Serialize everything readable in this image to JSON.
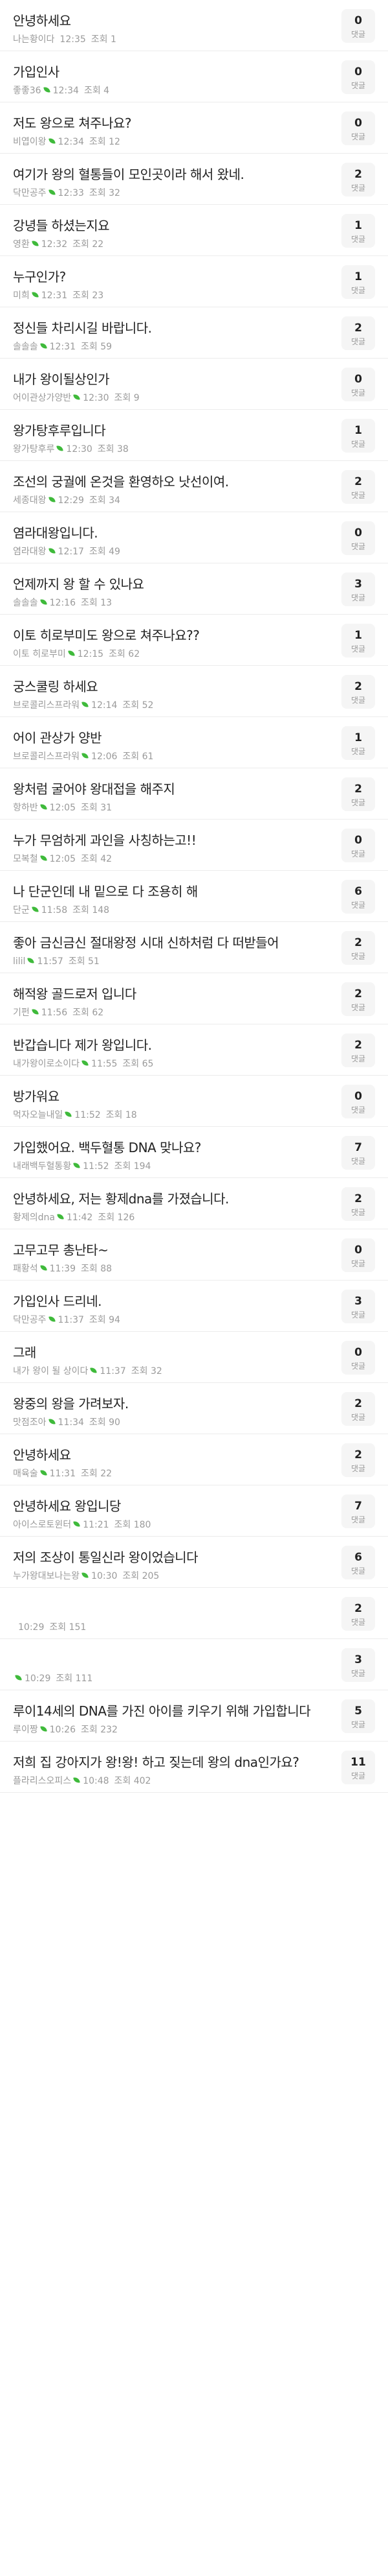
{
  "comment_label": "댓글",
  "colors": {
    "leaf_accent": "#3fba3b",
    "comment_box_bg": "#f5f5f5"
  },
  "posts": [
    {
      "title": "안녕하세요",
      "author": "나는황이다",
      "verified": false,
      "time": "12:35",
      "views": "조회 1",
      "comments": "0"
    },
    {
      "title": "가입인사",
      "author": "좋좋36",
      "verified": true,
      "time": "12:34",
      "views": "조회 4",
      "comments": "0"
    },
    {
      "title": "저도 왕으로 쳐주나요?",
      "author": "비엽이왕",
      "verified": true,
      "time": "12:34",
      "views": "조회 12",
      "comments": "0"
    },
    {
      "title": "여기가 왕의 혈통들이 모인곳이라 해서 왔네.",
      "author": "닥만공주",
      "verified": true,
      "time": "12:33",
      "views": "조회 32",
      "comments": "2"
    },
    {
      "title": "강녕들 하셨는지요",
      "author": "영환",
      "verified": true,
      "time": "12:32",
      "views": "조회 22",
      "comments": "1"
    },
    {
      "title": "누구인가?",
      "author": "미희",
      "verified": true,
      "time": "12:31",
      "views": "조회 23",
      "comments": "1"
    },
    {
      "title": "정신들 차리시길 바랍니다.",
      "author": "솔솔솔",
      "verified": true,
      "time": "12:31",
      "views": "조회 59",
      "comments": "2"
    },
    {
      "title": "내가 왕이될상인가",
      "author": "어이관상가양반",
      "verified": true,
      "time": "12:30",
      "views": "조회 9",
      "comments": "0"
    },
    {
      "title": "왕가탕후루입니다",
      "author": "왕가탕후루",
      "verified": true,
      "time": "12:30",
      "views": "조회 38",
      "comments": "1"
    },
    {
      "title": "조선의 궁궐에 온것을 환영하오 낫선이여.",
      "author": "세종대왕",
      "verified": true,
      "time": "12:29",
      "views": "조회 34",
      "comments": "2"
    },
    {
      "title": "염라대왕입니다.",
      "author": "염라대왕",
      "verified": true,
      "time": "12:17",
      "views": "조회 49",
      "comments": "0"
    },
    {
      "title": "언제까지 왕 할 수 있나요",
      "author": "솔솔솔",
      "verified": true,
      "time": "12:16",
      "views": "조회 13",
      "comments": "3"
    },
    {
      "title": "이토 히로부미도 왕으로 쳐주나요??",
      "author": "이토 히로부미",
      "verified": true,
      "time": "12:15",
      "views": "조회 62",
      "comments": "1"
    },
    {
      "title": "궁스쿨링 하세요",
      "author": "브로콜리스프라워",
      "verified": true,
      "time": "12:14",
      "views": "조회 52",
      "comments": "2"
    },
    {
      "title": "어이 관상가 양반",
      "author": "브로콜리스프라워",
      "verified": true,
      "time": "12:06",
      "views": "조회 61",
      "comments": "1"
    },
    {
      "title": "왕처럼 굴어야 왕대접을 해주지",
      "author": "항하반",
      "verified": true,
      "time": "12:05",
      "views": "조회 31",
      "comments": "2"
    },
    {
      "title": "누가 무엄하게 과인을 사칭하는고!!",
      "author": "모복철",
      "verified": true,
      "time": "12:05",
      "views": "조회 42",
      "comments": "0"
    },
    {
      "title": "나 단군인데 내 밑으로 다 조용히 해",
      "author": "단군",
      "verified": true,
      "time": "11:58",
      "views": "조회 148",
      "comments": "6"
    },
    {
      "title": "좋아 금신금신 절대왕정 시대 신하처럼 다 떠받들어",
      "author": "lilil",
      "verified": true,
      "time": "11:57",
      "views": "조회 51",
      "comments": "2"
    },
    {
      "title": "해적왕 골드로저 입니다",
      "author": "기펀",
      "verified": true,
      "time": "11:56",
      "views": "조회 62",
      "comments": "2"
    },
    {
      "title": "반갑습니다 제가 왕입니다.",
      "author": "내가왕이로소이다",
      "verified": true,
      "time": "11:55",
      "views": "조회 65",
      "comments": "2"
    },
    {
      "title": "방가워요",
      "author": "먹자오늘내일",
      "verified": true,
      "time": "11:52",
      "views": "조회 18",
      "comments": "0"
    },
    {
      "title": "가입했어요. 백두혈통 DNA 맞나요?",
      "author": "내래백두혈통황",
      "verified": true,
      "time": "11:52",
      "views": "조회 194",
      "comments": "7"
    },
    {
      "title": "안녕하세요, 저는 황제dna를 가졌습니다.",
      "author": "황제의dna",
      "verified": true,
      "time": "11:42",
      "views": "조회 126",
      "comments": "2"
    },
    {
      "title": "고무고무 총난타~",
      "author": "패황석",
      "verified": true,
      "time": "11:39",
      "views": "조회 88",
      "comments": "0"
    },
    {
      "title": "가입인사 드리네.",
      "author": "닥만공주",
      "verified": true,
      "time": "11:37",
      "views": "조회 94",
      "comments": "3"
    },
    {
      "title": "그래",
      "author": "내가 왕이 될 상이다",
      "verified": true,
      "time": "11:37",
      "views": "조회 32",
      "comments": "0"
    },
    {
      "title": "왕중의 왕을 가려보자.",
      "author": "맛점조아",
      "verified": true,
      "time": "11:34",
      "views": "조회 90",
      "comments": "2"
    },
    {
      "title": "안녕하세요",
      "author": "매육술",
      "verified": true,
      "time": "11:31",
      "views": "조회 22",
      "comments": "2"
    },
    {
      "title": "안녕하세요 왕입니당",
      "author": "아이스로토윈터",
      "verified": true,
      "time": "11:21",
      "views": "조회 180",
      "comments": "7"
    },
    {
      "title": "저의 조상이 통일신라 왕이었습니다",
      "author": "누가왕대보나는왕",
      "verified": true,
      "time": "10:30",
      "views": "조회 205",
      "comments": "6"
    },
    {
      "title": "",
      "author": "",
      "verified": false,
      "time": "10:29",
      "views": "조회 151",
      "comments": "2",
      "blurred": true
    },
    {
      "title": "",
      "author": "",
      "verified": true,
      "time": "10:29",
      "views": "조회 111",
      "comments": "3",
      "blurred": true
    },
    {
      "title": "루이14세의 DNA를 가진 아이를 키우기 위해 가입합니다",
      "author": "루이짱",
      "verified": true,
      "time": "10:26",
      "views": "조회 232",
      "comments": "5"
    },
    {
      "title": "저희 집 강아지가 왕!왕! 하고 짖는데 왕의 dna인가요?",
      "author": "플라리스오피스",
      "verified": true,
      "time": "10:48",
      "views": "조회 402",
      "comments": "11"
    }
  ]
}
